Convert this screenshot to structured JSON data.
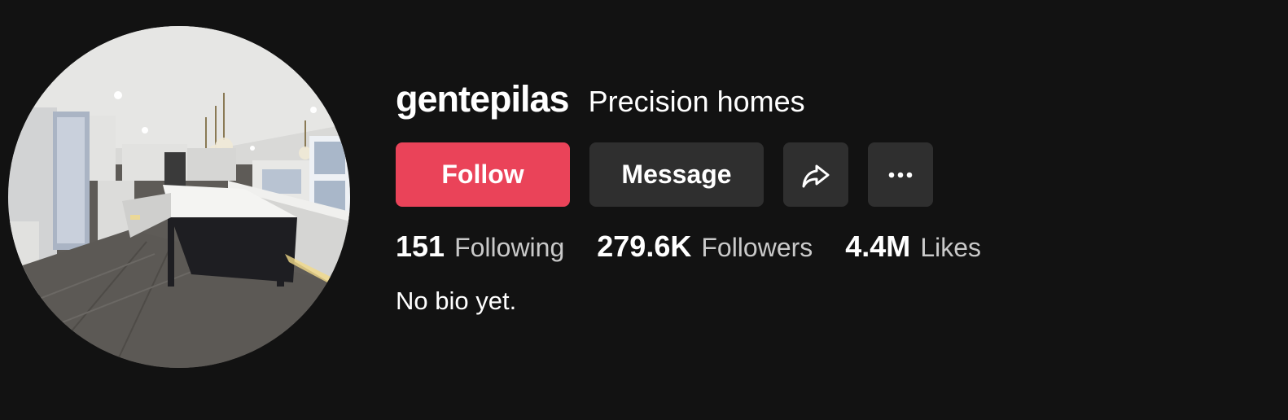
{
  "profile": {
    "username": "gentepilas",
    "nickname": "Precision homes",
    "avatar_icon": "kitchen-photo-avatar",
    "bio": "No bio yet."
  },
  "actions": {
    "follow_label": "Follow",
    "message_label": "Message",
    "share_icon": "share-arrow-icon",
    "more_icon": "more-dots-icon"
  },
  "stats": {
    "following": {
      "value": "151",
      "label": "Following"
    },
    "followers": {
      "value": "279.6K",
      "label": "Followers"
    },
    "likes": {
      "value": "4.4M",
      "label": "Likes"
    }
  },
  "colors": {
    "background": "#121212",
    "follow": "#ea4359",
    "secondary_button": "#2f2f2f",
    "label_text": "#c9c9c9"
  }
}
